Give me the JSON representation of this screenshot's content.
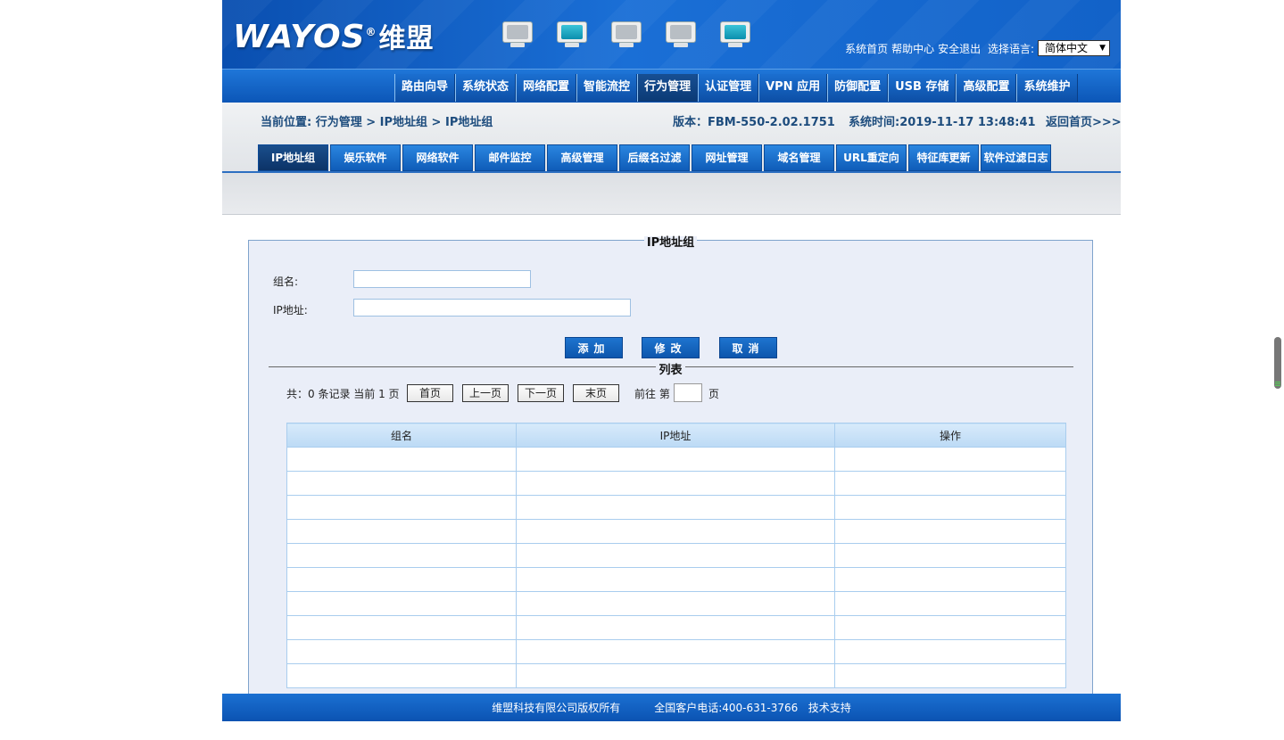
{
  "brand": {
    "logo_text": "WAYOS",
    "logo_reg": "®",
    "logo_cn": "维盟"
  },
  "header_links": [
    "系统首页",
    "帮助中心",
    "安全退出"
  ],
  "language": {
    "label": "选择语言:",
    "selected": "简体中文"
  },
  "main_nav": [
    {
      "label": "路由向导",
      "active": false
    },
    {
      "label": "系统状态",
      "active": false
    },
    {
      "label": "网络配置",
      "active": false
    },
    {
      "label": "智能流控",
      "active": false
    },
    {
      "label": "行为管理",
      "active": true
    },
    {
      "label": "认证管理",
      "active": false
    },
    {
      "label": "VPN 应用",
      "active": false
    },
    {
      "label": "防御配置",
      "active": false
    },
    {
      "label": "USB 存储",
      "active": false
    },
    {
      "label": "高级配置",
      "active": false
    },
    {
      "label": "系统维护",
      "active": false
    }
  ],
  "location": {
    "text": "当前位置:  行为管理 > IP地址组 > IP地址组"
  },
  "version": {
    "text": "版本：FBM-550-2.02.1751"
  },
  "system_time": {
    "text": "系统时间:2019-11-17 13:48:41"
  },
  "back_home": {
    "text": "返回首页>>>"
  },
  "sub_tabs": [
    {
      "label": "IP地址组",
      "active": true
    },
    {
      "label": "娱乐软件",
      "active": false
    },
    {
      "label": "网络软件",
      "active": false
    },
    {
      "label": "邮件监控",
      "active": false
    },
    {
      "label": "高级管理",
      "active": false
    },
    {
      "label": "后缀名过滤",
      "active": false
    },
    {
      "label": "网址管理",
      "active": false
    },
    {
      "label": "域名管理",
      "active": false
    },
    {
      "label": "URL重定向",
      "active": false
    },
    {
      "label": "特征库更新",
      "active": false
    },
    {
      "label": "软件过滤日志",
      "active": false
    }
  ],
  "form": {
    "legend": "IP地址组",
    "group_name_label": "组名:",
    "group_name_value": "",
    "ip_label": "IP地址:",
    "ip_value": "",
    "add_label": "添加",
    "modify_label": "修改",
    "cancel_label": "取消"
  },
  "list": {
    "legend": "列表",
    "summary": "共：0 条记录 当前 1 页",
    "first": "首页",
    "prev": "上一页",
    "next": "下一页",
    "last": "末页",
    "goto_label": "前往 第",
    "goto_value": "",
    "page_suffix": "页",
    "columns": [
      "组名",
      "IP地址",
      "操作"
    ],
    "empty_rows": 10
  },
  "footer": {
    "copyright": "维盟科技有限公司版权所有",
    "phone": "全国客户电话:400-631-3766",
    "support": "技术支持"
  },
  "colors": {
    "header_blue": "#1262c8",
    "nav_active": "#0b3a75",
    "panel_bg": "#eaeef8",
    "table_header": "#cfe4f8"
  }
}
